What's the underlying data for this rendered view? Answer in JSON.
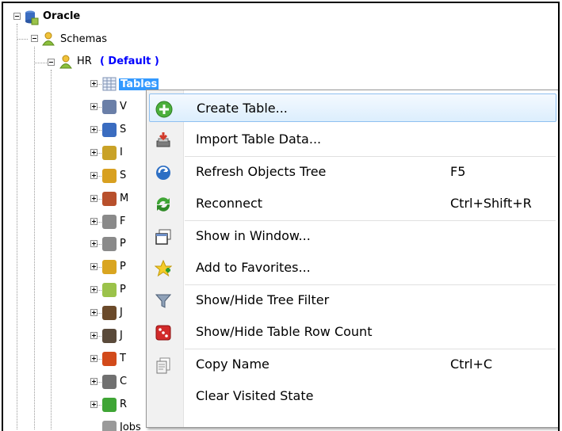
{
  "tree": {
    "root": "Oracle",
    "schemas": "Schemas",
    "schema_name": "HR",
    "schema_tag": "( Default )",
    "selected": "Tables",
    "partial_items": [
      "V",
      "S",
      "I",
      "S",
      "M",
      "F",
      "P",
      "P",
      "P",
      "J",
      "J",
      "T",
      "C",
      "R"
    ],
    "partial_last": "Jobs"
  },
  "menu": {
    "items": [
      {
        "label": "Create Table...",
        "shortcut": "",
        "icon": "add-green-icon"
      },
      {
        "label": "Import Table Data...",
        "shortcut": "",
        "icon": "import-icon"
      },
      {
        "label": "Refresh Objects Tree",
        "shortcut": "F5",
        "icon": "refresh-icon"
      },
      {
        "label": "Reconnect",
        "shortcut": "Ctrl+Shift+R",
        "icon": "reconnect-icon"
      },
      {
        "label": "Show in Window...",
        "shortcut": "",
        "icon": "window-icon"
      },
      {
        "label": "Add to Favorites...",
        "shortcut": "",
        "icon": "favorites-star-icon"
      },
      {
        "label": "Show/Hide Tree Filter",
        "shortcut": "",
        "icon": "filter-icon"
      },
      {
        "label": "Show/Hide Table Row Count",
        "shortcut": "",
        "icon": "dice-icon"
      },
      {
        "label": "Copy Name",
        "shortcut": "Ctrl+C",
        "icon": "copy-icon"
      },
      {
        "label": "Clear Visited State",
        "shortcut": "",
        "icon": ""
      }
    ]
  },
  "colors": {
    "selection": "#3399ff",
    "default_tag": "#0000ff",
    "menu_highlight": "#dceefd"
  }
}
